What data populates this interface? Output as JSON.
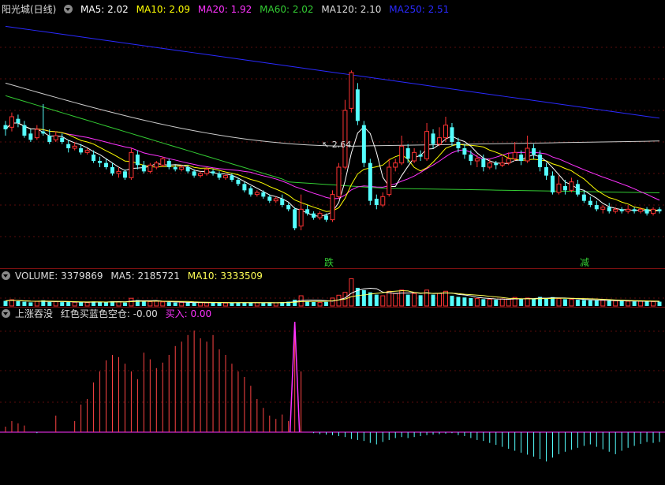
{
  "header": {
    "stock": "阳光城(日线)",
    "ma": [
      {
        "label": "MA5: 2.02",
        "color": "#ffffff"
      },
      {
        "label": "MA10: 2.09",
        "color": "#ffff00"
      },
      {
        "label": "MA20: 1.92",
        "color": "#ff33ff"
      },
      {
        "label": "MA60: 2.02",
        "color": "#33cc33"
      },
      {
        "label": "MA120: 2.10",
        "color": "#dddddd"
      },
      {
        "label": "MA250: 2.51",
        "color": "#2a2aff"
      }
    ]
  },
  "volume_header": {
    "volume": "VOLUME: 3379869",
    "ma5": "MA5: 2185721",
    "ma10": "MA10: 3333509",
    "ma10_color": "#ffff55"
  },
  "indicator_header": {
    "name": "上涨吞没",
    "red_blue": "红色买蓝色空仓: -0.00",
    "buy": "买入: 0.00",
    "buy_color": "#ff33ff"
  },
  "annotations": {
    "peak": "2.64",
    "marker1": "跌",
    "marker2": "减",
    "marker_color": "#33cc33"
  },
  "colors": {
    "up": "#ff3333",
    "down": "#55ffff",
    "ma250": "#2a2aff",
    "ma120": "#cccccc",
    "ma60": "#33cc33",
    "ma20": "#ff33ff",
    "ma10": "#ffff00",
    "ma5": "#ffffff"
  },
  "chart_data": {
    "type": "candlestick",
    "candles": [
      [
        2.38,
        2.36,
        2.4,
        2.33
      ],
      [
        2.37,
        2.42,
        2.44,
        2.35
      ],
      [
        2.41,
        2.39,
        2.43,
        2.37
      ],
      [
        2.38,
        2.33,
        2.4,
        2.32
      ],
      [
        2.34,
        2.31,
        2.36,
        2.3
      ],
      [
        2.32,
        2.36,
        2.38,
        2.31
      ],
      [
        2.35,
        2.34,
        2.48,
        2.33
      ],
      [
        2.33,
        2.3,
        2.36,
        2.29
      ],
      [
        2.31,
        2.33,
        2.35,
        2.3
      ],
      [
        2.32,
        2.3,
        2.34,
        2.29
      ],
      [
        2.29,
        2.27,
        2.31,
        2.25
      ],
      [
        2.27,
        2.28,
        2.3,
        2.26
      ],
      [
        2.27,
        2.25,
        2.29,
        2.24
      ],
      [
        2.25,
        2.26,
        2.27,
        2.24
      ],
      [
        2.24,
        2.21,
        2.26,
        2.2
      ],
      [
        2.21,
        2.2,
        2.23,
        2.18
      ],
      [
        2.2,
        2.18,
        2.22,
        2.17
      ],
      [
        2.18,
        2.15,
        2.2,
        2.14
      ],
      [
        2.15,
        2.16,
        2.18,
        2.13
      ],
      [
        2.16,
        2.13,
        2.17,
        2.12
      ],
      [
        2.13,
        2.25,
        2.27,
        2.12
      ],
      [
        2.24,
        2.19,
        2.26,
        2.17
      ],
      [
        2.19,
        2.16,
        2.21,
        2.15
      ],
      [
        2.16,
        2.19,
        2.2,
        2.15
      ],
      [
        2.18,
        2.2,
        2.21,
        2.17
      ],
      [
        2.19,
        2.22,
        2.23,
        2.18
      ],
      [
        2.21,
        2.18,
        2.22,
        2.17
      ],
      [
        2.18,
        2.17,
        2.19,
        2.16
      ],
      [
        2.17,
        2.18,
        2.19,
        2.16
      ],
      [
        2.18,
        2.16,
        2.19,
        2.15
      ],
      [
        2.16,
        2.14,
        2.17,
        2.13
      ],
      [
        2.14,
        2.15,
        2.16,
        2.13
      ],
      [
        2.15,
        2.17,
        2.18,
        2.14
      ],
      [
        2.16,
        2.15,
        2.17,
        2.14
      ],
      [
        2.15,
        2.13,
        2.16,
        2.12
      ],
      [
        2.13,
        2.14,
        2.15,
        2.12
      ],
      [
        2.14,
        2.12,
        2.15,
        2.11
      ],
      [
        2.12,
        2.1,
        2.13,
        2.09
      ],
      [
        2.1,
        2.07,
        2.11,
        2.06
      ],
      [
        2.08,
        2.05,
        2.09,
        2.04
      ],
      [
        2.05,
        2.06,
        2.07,
        2.04
      ],
      [
        2.06,
        2.04,
        2.07,
        2.03
      ],
      [
        2.04,
        2.02,
        2.05,
        2.01
      ],
      [
        2.02,
        2.03,
        2.04,
        2.01
      ],
      [
        2.03,
        2.0,
        2.05,
        1.99
      ],
      [
        2.0,
        1.98,
        2.01,
        1.97
      ],
      [
        1.98,
        1.89,
        1.99,
        1.88
      ],
      [
        1.9,
        1.98,
        2.05,
        1.88
      ],
      [
        1.98,
        1.96,
        2.0,
        1.95
      ],
      [
        1.96,
        1.94,
        1.97,
        1.93
      ],
      [
        1.94,
        1.96,
        1.97,
        1.93
      ],
      [
        1.95,
        1.93,
        1.96,
        1.92
      ],
      [
        1.93,
        2.05,
        2.07,
        1.92
      ],
      [
        2.04,
        2.18,
        2.2,
        2.03
      ],
      [
        2.18,
        2.45,
        2.5,
        2.17
      ],
      [
        2.46,
        2.63,
        2.64,
        2.44
      ],
      [
        2.55,
        2.4,
        2.58,
        2.38
      ],
      [
        2.38,
        2.2,
        2.4,
        2.18
      ],
      [
        2.2,
        2.02,
        2.22,
        2.0
      ],
      [
        2.03,
        2.0,
        2.05,
        1.98
      ],
      [
        2.0,
        2.04,
        2.06,
        1.99
      ],
      [
        2.05,
        2.18,
        2.22,
        2.04
      ],
      [
        2.18,
        2.2,
        2.22,
        2.16
      ],
      [
        2.2,
        2.28,
        2.33,
        2.19
      ],
      [
        2.27,
        2.22,
        2.29,
        2.2
      ],
      [
        2.21,
        2.25,
        2.27,
        2.2
      ],
      [
        2.24,
        2.23,
        2.26,
        2.21
      ],
      [
        2.22,
        2.35,
        2.39,
        2.21
      ],
      [
        2.34,
        2.29,
        2.36,
        2.27
      ],
      [
        2.29,
        2.32,
        2.37,
        2.28
      ],
      [
        2.32,
        2.38,
        2.42,
        2.3
      ],
      [
        2.37,
        2.3,
        2.39,
        2.28
      ],
      [
        2.3,
        2.27,
        2.32,
        2.25
      ],
      [
        2.27,
        2.24,
        2.29,
        2.22
      ],
      [
        2.24,
        2.21,
        2.26,
        2.19
      ],
      [
        2.21,
        2.22,
        2.24,
        2.18
      ],
      [
        2.22,
        2.18,
        2.24,
        2.16
      ],
      [
        2.18,
        2.2,
        2.22,
        2.17
      ],
      [
        2.2,
        2.19,
        2.21,
        2.17
      ],
      [
        2.19,
        2.2,
        2.23,
        2.18
      ],
      [
        2.2,
        2.22,
        2.25,
        2.19
      ],
      [
        2.22,
        2.25,
        2.3,
        2.21
      ],
      [
        2.24,
        2.21,
        2.26,
        2.19
      ],
      [
        2.21,
        2.27,
        2.33,
        2.2
      ],
      [
        2.27,
        2.24,
        2.29,
        2.22
      ],
      [
        2.24,
        2.18,
        2.26,
        2.16
      ],
      [
        2.18,
        2.14,
        2.2,
        2.12
      ],
      [
        2.14,
        2.06,
        2.16,
        2.05
      ],
      [
        2.06,
        2.1,
        2.14,
        2.05
      ],
      [
        2.09,
        2.07,
        2.12,
        2.05
      ],
      [
        2.07,
        2.11,
        2.13,
        2.06
      ],
      [
        2.1,
        2.05,
        2.12,
        2.04
      ],
      [
        2.05,
        2.02,
        2.07,
        2.01
      ],
      [
        2.02,
        2.0,
        2.04,
        1.99
      ],
      [
        2.0,
        1.98,
        2.02,
        1.97
      ],
      [
        1.98,
        1.99,
        2.0,
        1.96
      ],
      [
        1.99,
        1.97,
        2.01,
        1.96
      ],
      [
        1.97,
        1.98,
        1.99,
        1.96
      ],
      [
        1.98,
        1.97,
        1.99,
        1.96
      ],
      [
        1.97,
        1.98,
        2.0,
        1.96
      ],
      [
        1.98,
        1.97,
        1.99,
        1.96
      ],
      [
        1.97,
        1.98,
        1.99,
        1.96
      ],
      [
        1.98,
        1.96,
        1.99,
        1.95
      ],
      [
        1.96,
        1.98,
        1.99,
        1.95
      ],
      [
        1.98,
        1.97,
        1.99,
        1.96
      ]
    ],
    "volume": [
      0.45,
      0.55,
      0.42,
      0.38,
      0.32,
      0.4,
      0.5,
      0.35,
      0.38,
      0.34,
      0.36,
      0.33,
      0.32,
      0.3,
      0.4,
      0.38,
      0.35,
      0.42,
      0.38,
      0.3,
      0.68,
      0.52,
      0.4,
      0.38,
      0.42,
      0.36,
      0.34,
      0.3,
      0.32,
      0.3,
      0.28,
      0.3,
      0.28,
      0.32,
      0.3,
      0.26,
      0.28,
      0.3,
      0.32,
      0.3,
      0.28,
      0.26,
      0.3,
      0.28,
      0.34,
      0.38,
      0.55,
      0.9,
      0.4,
      0.35,
      0.32,
      0.36,
      0.7,
      0.95,
      1.2,
      2.4,
      1.6,
      1.4,
      1.2,
      1.0,
      0.9,
      1.3,
      1.1,
      1.4,
      1.0,
      1.1,
      0.95,
      1.4,
      1.0,
      1.1,
      1.3,
      0.9,
      0.8,
      0.75,
      0.7,
      0.65,
      0.6,
      0.6,
      0.55,
      0.62,
      0.6,
      0.75,
      0.6,
      0.7,
      0.62,
      0.8,
      0.7,
      0.78,
      0.65,
      0.6,
      0.58,
      0.55,
      0.52,
      0.5,
      0.48,
      0.5,
      0.45,
      0.46,
      0.44,
      0.42,
      0.4,
      0.42,
      0.4,
      0.38,
      0.38
    ],
    "indicator": [
      0.05,
      0.1,
      0.08,
      0.06,
      0.0,
      -0.02,
      0.0,
      0.0,
      0.15,
      0.0,
      0.0,
      0.1,
      0.25,
      0.3,
      0.45,
      0.55,
      0.65,
      0.7,
      0.68,
      0.62,
      0.55,
      0.48,
      0.72,
      0.66,
      0.58,
      0.63,
      0.7,
      0.78,
      0.82,
      0.88,
      0.92,
      0.85,
      0.82,
      0.88,
      0.75,
      0.7,
      0.62,
      0.55,
      0.5,
      0.42,
      0.3,
      0.22,
      0.15,
      0.12,
      0.16,
      0.1,
      1.0,
      0.55,
      0.0,
      -0.02,
      -0.04,
      -0.05,
      -0.06,
      -0.08,
      -0.1,
      -0.14,
      -0.16,
      -0.18,
      -0.22,
      -0.25,
      -0.2,
      -0.16,
      -0.12,
      -0.1,
      -0.12,
      -0.1,
      -0.08,
      -0.06,
      -0.05,
      -0.04,
      -0.03,
      -0.02,
      -0.06,
      -0.08,
      -0.12,
      -0.16,
      -0.18,
      -0.22,
      -0.26,
      -0.3,
      -0.34,
      -0.38,
      -0.42,
      -0.46,
      -0.5,
      -0.55,
      -0.6,
      -0.52,
      -0.45,
      -0.4,
      -0.36,
      -0.32,
      -0.28,
      -0.25,
      -0.3,
      -0.35,
      -0.4,
      -0.45,
      -0.38,
      -0.32,
      -0.28,
      -0.24,
      -0.2,
      -0.22,
      -0.2
    ]
  }
}
